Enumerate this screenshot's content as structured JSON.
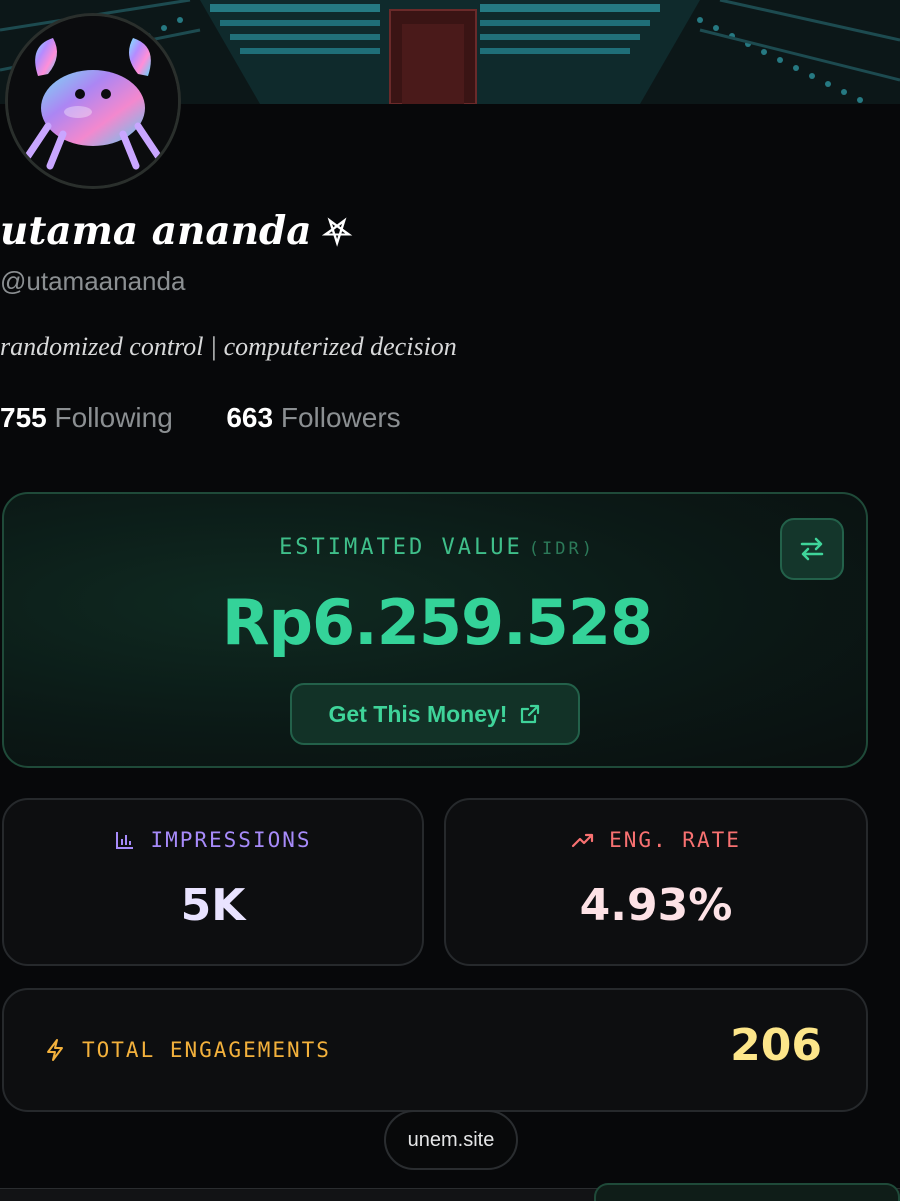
{
  "profile": {
    "name": "utama ananda",
    "badge": "⛧",
    "handle": "@utamaananda",
    "bio": "randomized control | computerized decision",
    "following_count": "755",
    "following_label": "Following",
    "followers_count": "663",
    "followers_label": "Followers"
  },
  "value_card": {
    "label": "ESTIMATED VALUE",
    "unit": "(IDR)",
    "amount": "Rp6.259.528",
    "button_label": "Get This Money!",
    "swap_icon": "swap-icon",
    "external_icon": "external-link-icon"
  },
  "metrics": {
    "impressions_label": "IMPRESSIONS",
    "impressions_value": "5K",
    "eng_rate_label": "ENG. RATE",
    "eng_rate_value": "4.93%",
    "total_label": "TOTAL ENGAGEMENTS",
    "total_value": "206"
  },
  "footer": {
    "site": "unem.site"
  },
  "colors": {
    "accent_green": "#34d399",
    "impressions_purple": "#a78bfa",
    "eng_rate_pink": "#f87171",
    "total_yellow": "#f3b13c"
  }
}
